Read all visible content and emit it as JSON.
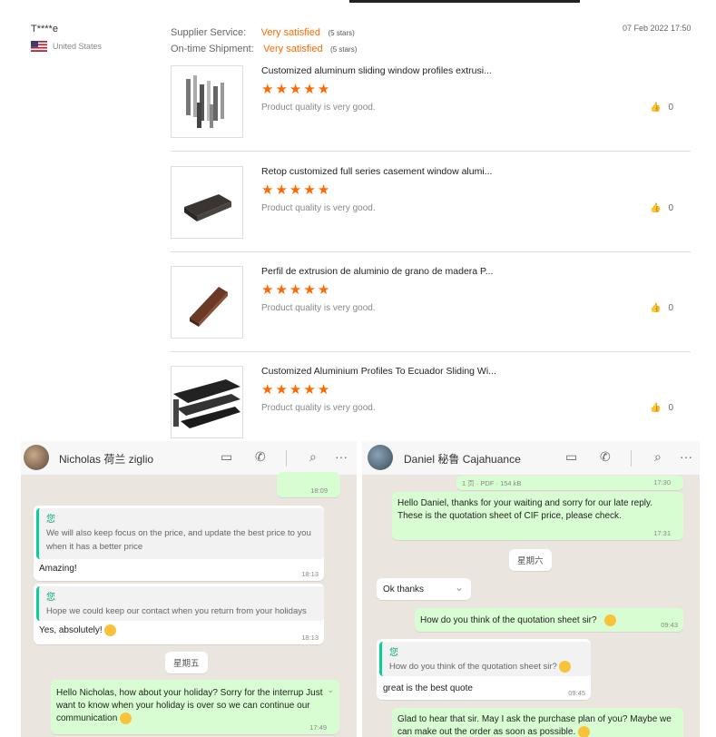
{
  "review": {
    "buyer": "T****e",
    "country": "United States",
    "supplier_service_label": "Supplier Service:",
    "supplier_service_value": "Very satisfied",
    "supplier_service_stars": "(5 stars)",
    "shipment_label": "On-time Shipment:",
    "shipment_value": "Very satisfied",
    "shipment_stars": "(5 stars)",
    "date": "07 Feb 2022 17:50",
    "products": [
      {
        "title": "Customized aluminum sliding window profiles extrusi...",
        "rating": 5,
        "comment": "Product quality is very good.",
        "likes": "0",
        "image": "window-profiles-photo"
      },
      {
        "title": "Retop customized full series casement window alumi...",
        "rating": 5,
        "comment": "Product quality is very good.",
        "likes": "0",
        "image": "casement-profile-photo"
      },
      {
        "title": "Perfil de extrusion de aluminio de grano de madera P...",
        "rating": 5,
        "comment": "Product quality is very good.",
        "likes": "0",
        "image": "wood-grain-profile-photo"
      },
      {
        "title": "Customized Aluminium Profiles To Ecuador Sliding Wi...",
        "rating": 5,
        "comment": "Product quality is very good.",
        "likes": "0",
        "image": "black-profiles-photo"
      }
    ]
  },
  "chat_left": {
    "contact": "Nicholas 荷兰 ziglio",
    "icons": [
      "video-icon",
      "phone-icon",
      "search-icon",
      "more-icon"
    ],
    "top_time": "18:09",
    "msg1_quote_name": "您",
    "msg1_quote": "We will also keep focus on the price, and update the best price to you when it has a better price",
    "msg1_text": "Amazing!",
    "msg1_time": "18:13",
    "msg2_quote_name": "您",
    "msg2_quote": "Hope we could keep our contact when you return from your holidays",
    "msg2_text": "Yes, absolutely!",
    "msg2_time": "18:13",
    "day": "星期五",
    "msg3_text": "Hello Nicholas, how about your holiday? Sorry for the interrup Just want to know when your holiday is over so we can continue our communication",
    "msg3_time": "17:49"
  },
  "chat_right": {
    "contact": "Daniel 秘鲁 Cajahuance",
    "icons": [
      "video-icon",
      "phone-icon",
      "search-icon",
      "more-icon"
    ],
    "file_info": "1 页 · PDF · 154 kB",
    "file_time": "17:30",
    "msg1_text": "Hello Daniel, thanks for your waiting and sorry for our late reply. These is the quotation sheet of CIF price, please check.",
    "msg1_time": "17:31",
    "day": "星期六",
    "msg2_text": "Ok thanks",
    "msg3_text": "How do you think of the quotation sheet sir?",
    "msg3_time": "09:43",
    "msg4_quote_name": "您",
    "msg4_quote": "How do you think of the quotation sheet sir?",
    "msg4_text": "great is the best quote",
    "msg4_time": "09:45",
    "msg5_text": "Glad to hear that sir. May I ask the purchase plan of you? Maybe we can make out the order as soon as possible."
  },
  "colors": {
    "accent": "#ff6a00",
    "chat_out": "#d9fdd3",
    "chat_bg": "#eae6df",
    "quote_bar": "#06cf9c"
  }
}
